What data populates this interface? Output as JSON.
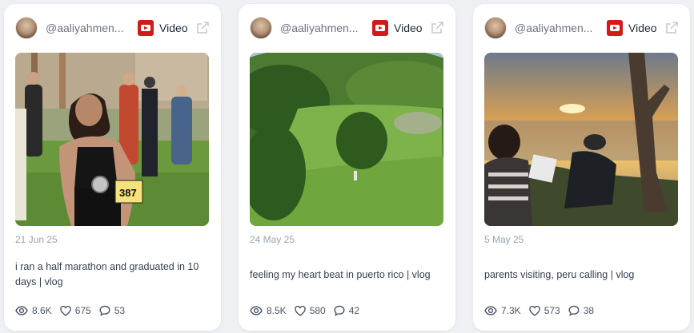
{
  "cards": [
    {
      "username": "@aaliyahmen...",
      "platform_label": "Video",
      "date": "21 Jun 25",
      "caption": "i ran a half marathon and graduated in 10 days | vlog",
      "views": "8.6K",
      "likes": "675",
      "comments": "53"
    },
    {
      "username": "@aaliyahmen...",
      "platform_label": "Video",
      "date": "24 May 25",
      "caption": "feeling my heart beat in puerto rico | vlog",
      "views": "8.5K",
      "likes": "580",
      "comments": "42"
    },
    {
      "username": "@aaliyahmen...",
      "platform_label": "Video",
      "date": "5 May 25",
      "caption": "parents visiting, peru calling | vlog",
      "views": "7.3K",
      "likes": "573",
      "comments": "38"
    }
  ],
  "colors": {
    "background": "#eef0f4",
    "card": "#ffffff",
    "youtube_red": "#d21a17",
    "muted_text": "#9ca3af"
  },
  "icons": {
    "platform": "youtube-icon",
    "external": "external-link-icon",
    "views": "eye-icon",
    "likes": "heart-icon",
    "comments": "comment-icon"
  }
}
